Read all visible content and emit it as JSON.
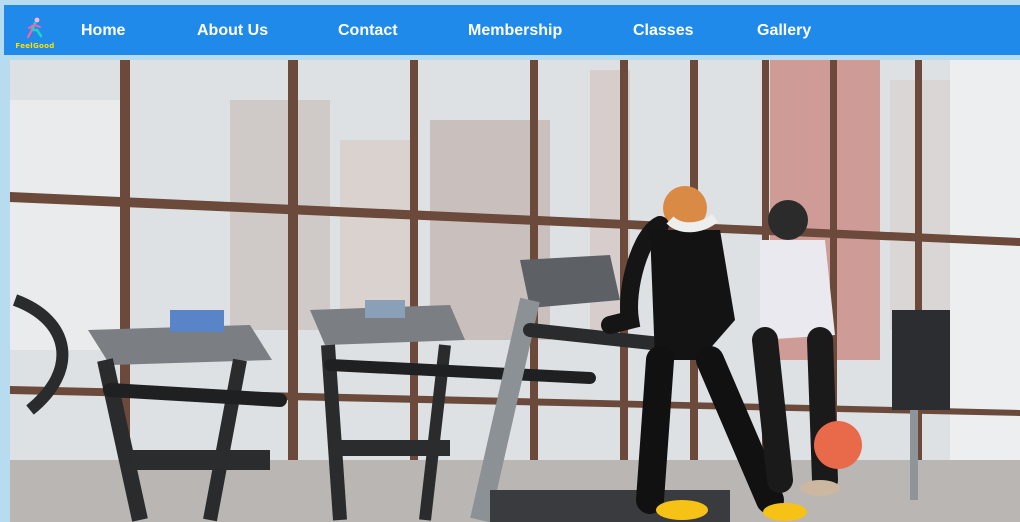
{
  "brand": {
    "logo_text": "FeelGood",
    "logo_icon": "runner-icon"
  },
  "nav": {
    "items": [
      {
        "label": "Home"
      },
      {
        "label": "About Us"
      },
      {
        "label": "Contact"
      },
      {
        "label": "Membership"
      },
      {
        "label": "Classes"
      },
      {
        "label": "Gallery"
      }
    ]
  },
  "hero": {
    "image": "gym-treadmill-photo"
  },
  "colors": {
    "navbar": "#1f8aea",
    "page_background": "#b7dcef",
    "logo_text": "#ffe000"
  }
}
